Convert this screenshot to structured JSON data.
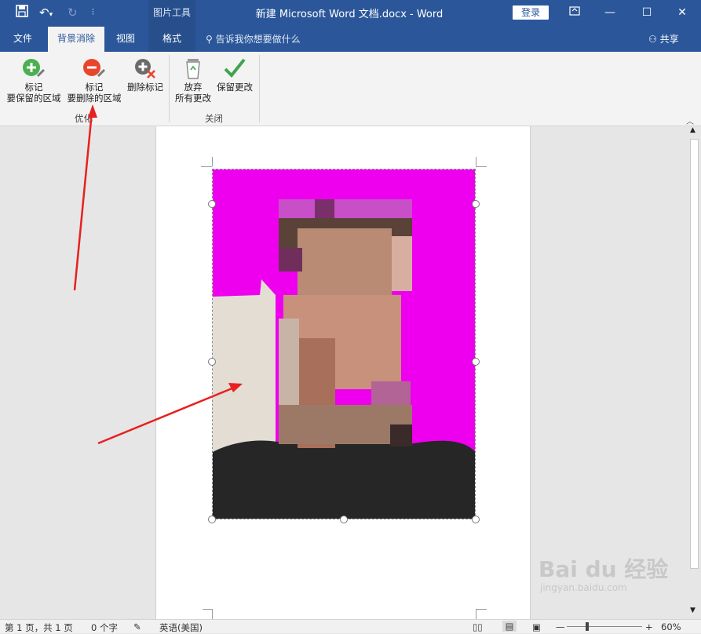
{
  "title_bar": {
    "picture_tools": "图片工具",
    "document_title": "新建 Microsoft Word 文档.docx  -  Word",
    "login": "登录"
  },
  "tabs": [
    {
      "label": "文件"
    },
    {
      "label": "背景消除"
    },
    {
      "label": "视图"
    },
    {
      "label": "格式"
    }
  ],
  "tell_me": "告诉我你想要做什么",
  "share": "共享",
  "ribbon": {
    "mark_keep_l1": "标记",
    "mark_keep_l2": "要保留的区域",
    "mark_remove_l1": "标记",
    "mark_remove_l2": "要删除的区域",
    "delete_mark": "删除标记",
    "refine_group": "优化",
    "discard_l1": "放弃",
    "discard_l2": "所有更改",
    "keep_changes": "保留更改",
    "close_group": "关闭"
  },
  "status_bar": {
    "page": "第 1 页，共 1 页",
    "words": "0 个字",
    "language": "英语(美国)",
    "zoom": "60%"
  },
  "watermark": {
    "brand": "Bai du 经验",
    "url": "jingyan.baidu.com"
  },
  "colors": {
    "title_blue": "#2b579a",
    "removed_area": "#ee00ee",
    "arrow": "#e8201e"
  }
}
